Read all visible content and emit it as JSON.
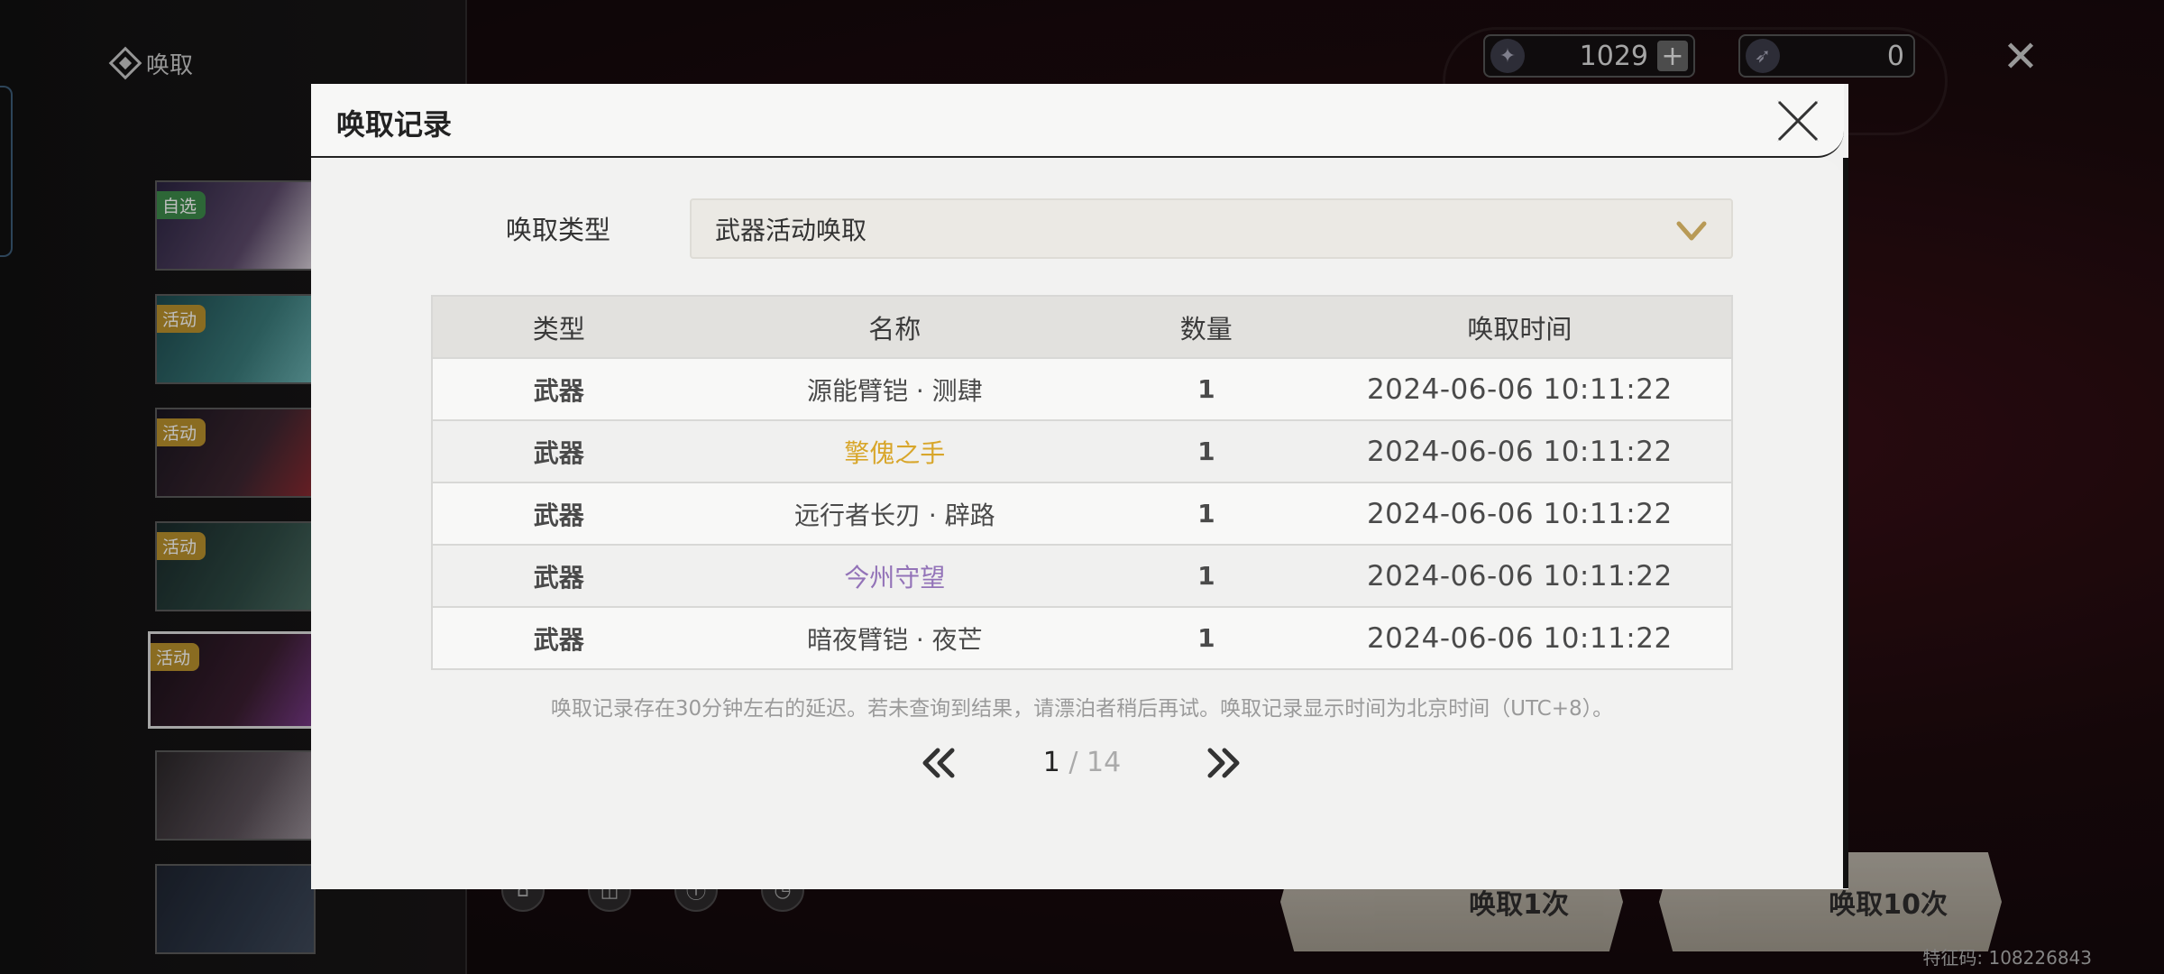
{
  "background": {
    "title": "唤取",
    "banner_tags": [
      "自选",
      "活动",
      "活动",
      "活动",
      "活动"
    ],
    "currency_star": "1029",
    "currency_pass": "0",
    "pull_one_label": "唤取1次",
    "pull_ten_label": "唤取10次",
    "fingerprint": "特征码: 108226843"
  },
  "modal": {
    "title": "唤取记录",
    "type_label": "唤取类型",
    "type_selected": "武器活动唤取",
    "columns": [
      "类型",
      "名称",
      "数量",
      "唤取时间"
    ],
    "rows": [
      {
        "type": "武器",
        "name": "源能臂铠 · 测肆",
        "qty": "1",
        "time": "2024-06-06 10:11:22",
        "rarity": "normal"
      },
      {
        "type": "武器",
        "name": "擎傀之手",
        "qty": "1",
        "time": "2024-06-06 10:11:22",
        "rarity": "gold"
      },
      {
        "type": "武器",
        "name": "远行者长刃 · 辟路",
        "qty": "1",
        "time": "2024-06-06 10:11:22",
        "rarity": "normal"
      },
      {
        "type": "武器",
        "name": "今州守望",
        "qty": "1",
        "time": "2024-06-06 10:11:22",
        "rarity": "purple"
      },
      {
        "type": "武器",
        "name": "暗夜臂铠 · 夜芒",
        "qty": "1",
        "time": "2024-06-06 10:11:22",
        "rarity": "normal"
      }
    ],
    "notice": "唤取记录存在30分钟左右的延迟。若未查询到结果，请漂泊者稍后再试。唤取记录显示时间为北京时间（UTC+8）。",
    "pager": {
      "current": "1",
      "separator": "/",
      "total": "14"
    }
  },
  "colors": {
    "gold": "#d8a62a",
    "purple": "#9373b8",
    "accent": "#b89a56"
  }
}
